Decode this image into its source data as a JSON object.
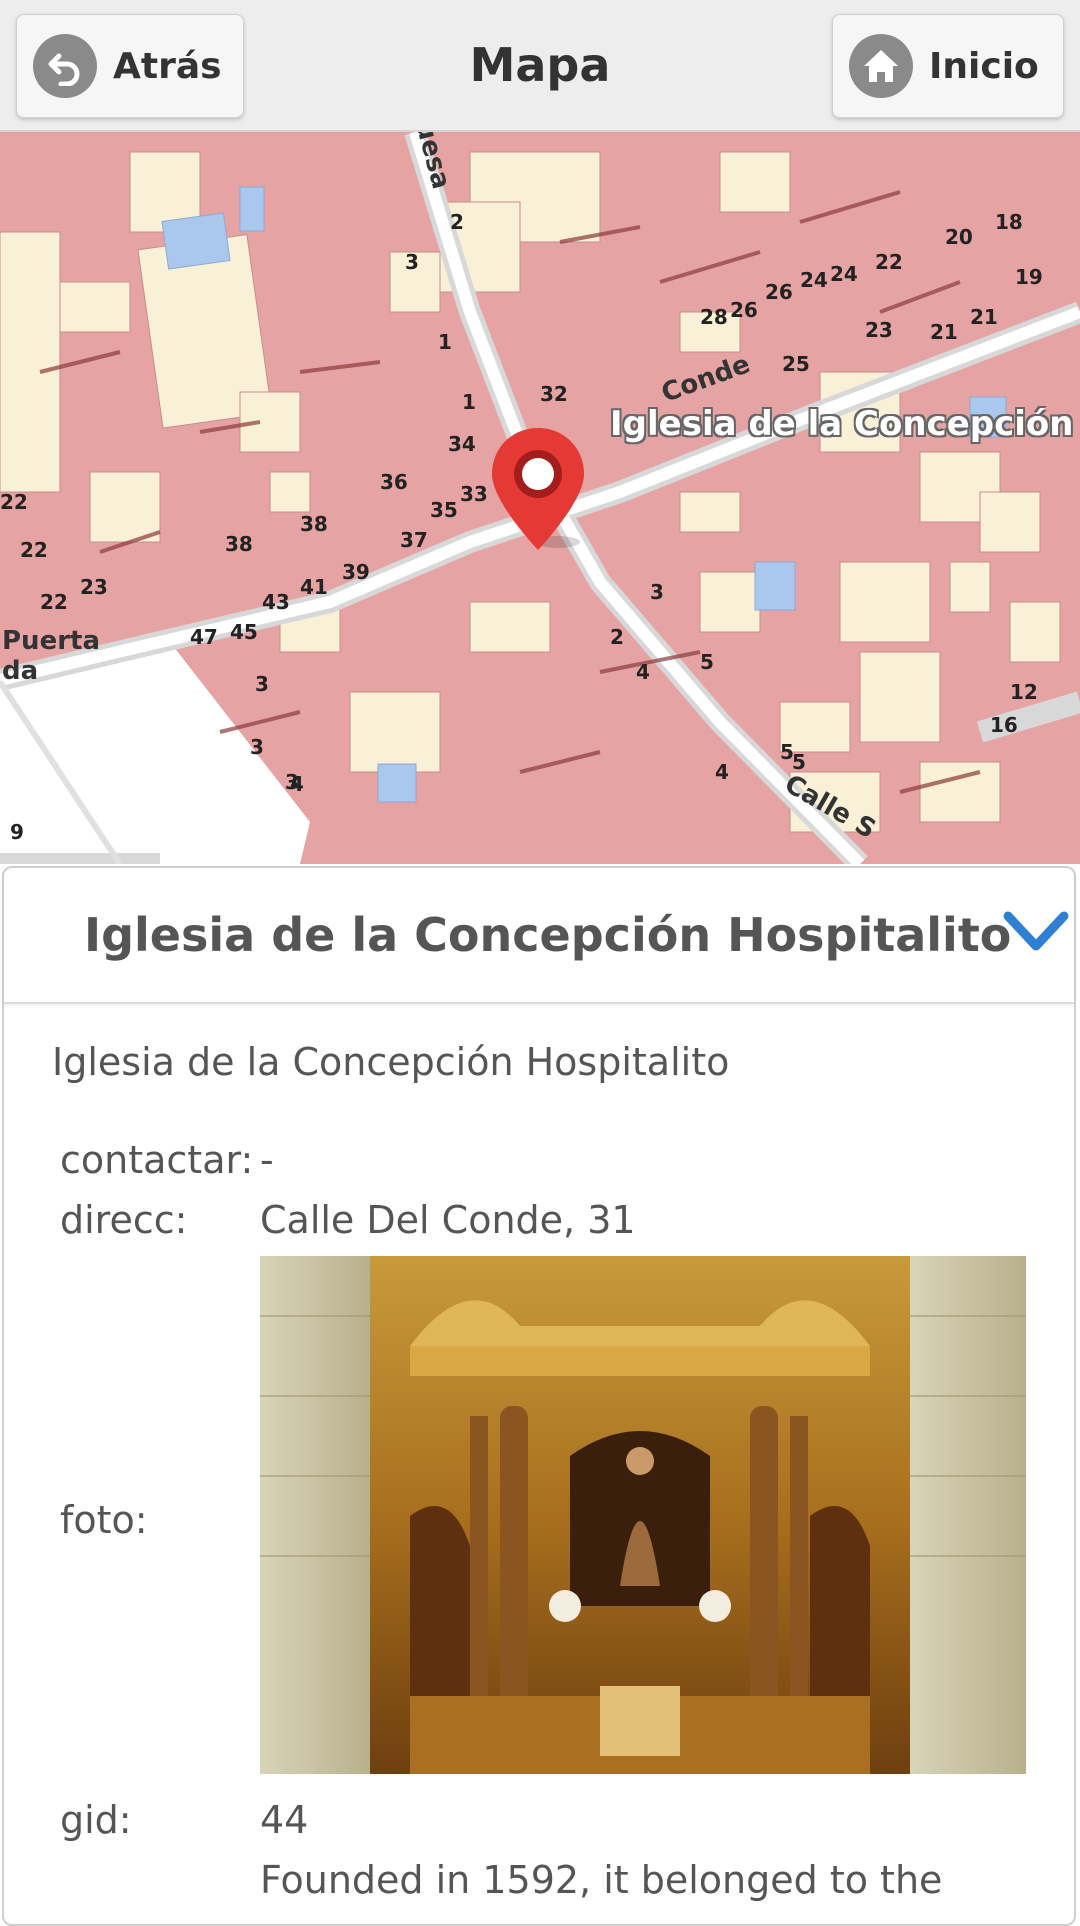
{
  "header": {
    "back_label": "Atrás",
    "title": "Mapa",
    "home_label": "Inicio"
  },
  "map": {
    "poi_label": "Iglesia de la Concepción Ho",
    "streets": [
      "Conde",
      "Calle S",
      "Puerta",
      "da",
      "uesa"
    ],
    "house_numbers": [
      "2",
      "3",
      "1",
      "1",
      "32",
      "34",
      "36",
      "38",
      "38",
      "37",
      "35",
      "33",
      "39",
      "41",
      "43",
      "45",
      "47",
      "22",
      "22",
      "22",
      "23",
      "28",
      "26",
      "26",
      "24",
      "24",
      "22",
      "20",
      "18",
      "19",
      "21",
      "21",
      "23",
      "25",
      "3",
      "2",
      "4",
      "5",
      "3",
      "4",
      "5",
      "12",
      "16",
      "3",
      "3",
      "4",
      "5",
      "9"
    ]
  },
  "panel": {
    "title": "Iglesia de la Concepción Hospitalito",
    "subtitle": "Iglesia de la Concepción Hospitalito",
    "fields": {
      "contact_label": "contactar:",
      "contact_value": "-",
      "address_label": "direcc:",
      "address_value": "Calle Del Conde, 31",
      "photo_label": "foto:",
      "gid_label": "gid:",
      "gid_value": "44",
      "description": "Founded in 1592, it belonged to the"
    }
  },
  "colors": {
    "accent": "#2f7fd2",
    "map_building": "#e6a3a3",
    "map_open": "#f9f0d8",
    "pin": "#e53935"
  },
  "icons": {
    "back": "back-arrow-icon",
    "home": "home-icon",
    "collapse": "chevron-down-icon",
    "pin": "map-pin-icon"
  }
}
